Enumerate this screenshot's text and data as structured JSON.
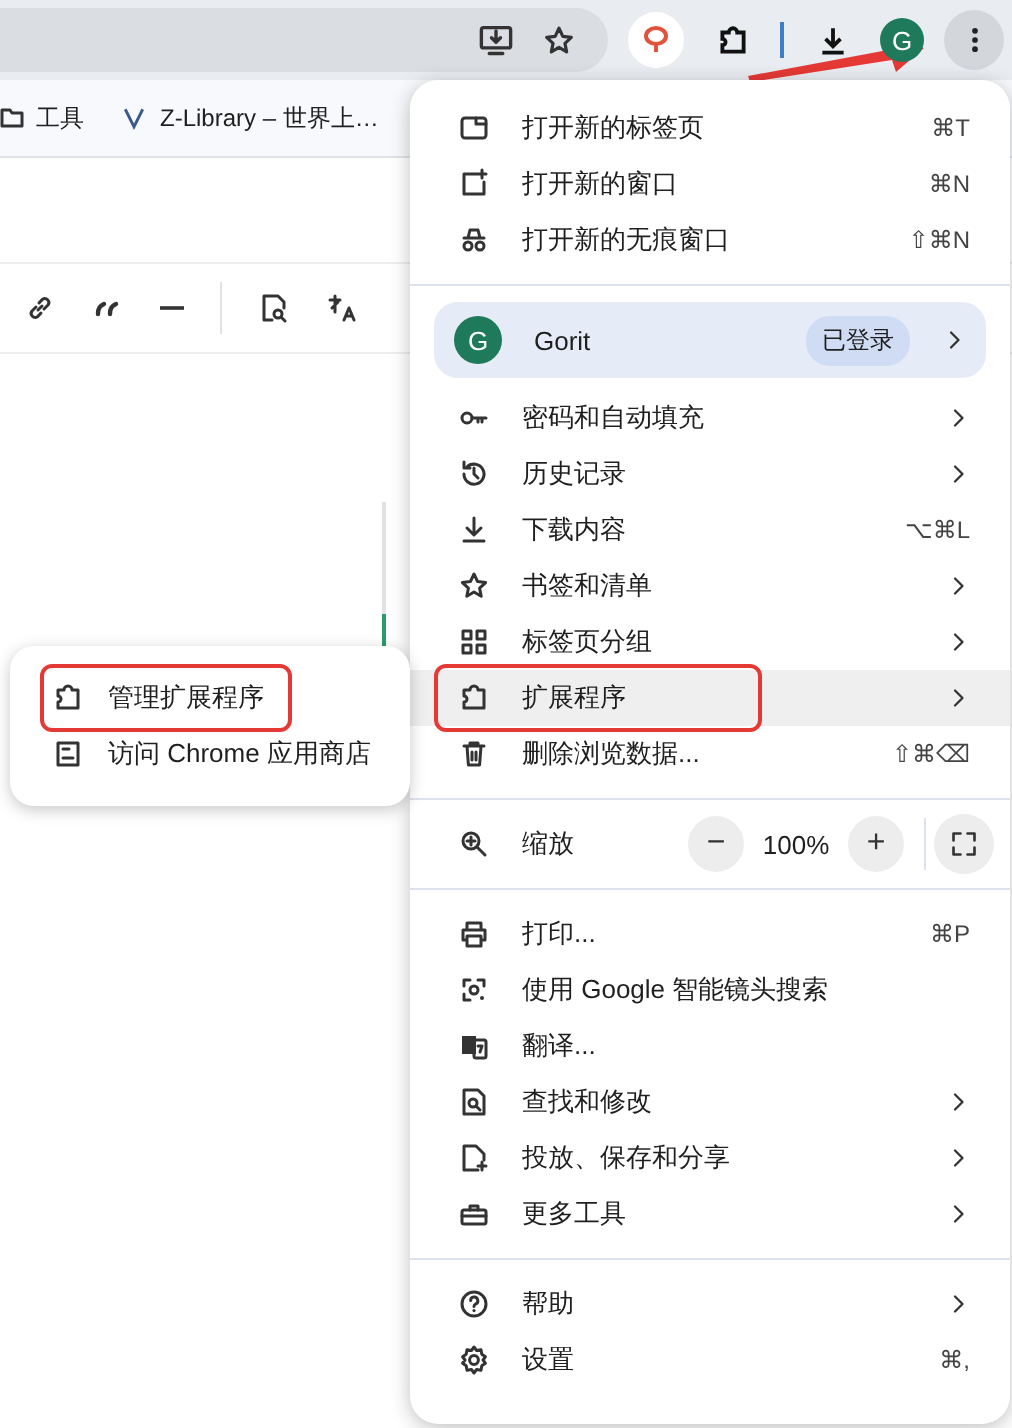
{
  "toolbar": {
    "avatar": "G",
    "bookmarks": [
      {
        "label": "工具"
      },
      {
        "label": "Z-Library – 世界上…"
      }
    ]
  },
  "menu": {
    "sections": [
      [
        {
          "kind": "item",
          "label": "打开新的标签页",
          "shortcut": "⌘T",
          "submenu": false,
          "selected": false,
          "annotated": false
        },
        {
          "kind": "item",
          "label": "打开新的窗口",
          "shortcut": "⌘N",
          "submenu": false,
          "selected": false,
          "annotated": false
        },
        {
          "kind": "item",
          "label": "打开新的无痕窗口",
          "shortcut": "⇧⌘N",
          "submenu": false,
          "selected": false,
          "annotated": false
        }
      ],
      [
        {
          "kind": "profile",
          "avatar": "G",
          "label": "Gorit",
          "badge": "已登录",
          "submenu": true
        },
        {
          "kind": "item",
          "label": "密码和自动填充",
          "submenu": true,
          "selected": false,
          "annotated": false
        },
        {
          "kind": "item",
          "label": "历史记录",
          "submenu": true,
          "selected": false,
          "annotated": false
        },
        {
          "kind": "item",
          "label": "下载内容",
          "shortcut": "⌥⌘L",
          "submenu": false,
          "selected": false,
          "annotated": false
        },
        {
          "kind": "item",
          "label": "书签和清单",
          "submenu": true,
          "selected": false,
          "annotated": false
        },
        {
          "kind": "item",
          "label": "标签页分组",
          "submenu": true,
          "selected": false,
          "annotated": false
        },
        {
          "kind": "item",
          "label": "扩展程序",
          "submenu": true,
          "selected": true,
          "annotated": true
        },
        {
          "kind": "item",
          "label": "删除浏览数据...",
          "shortcut": "⇧⌘⌫",
          "submenu": false,
          "selected": false,
          "annotated": false
        }
      ],
      [
        {
          "kind": "zoom",
          "label": "缩放",
          "minus": "−",
          "value": "100%",
          "plus": "+"
        }
      ],
      [
        {
          "kind": "item",
          "label": "打印...",
          "shortcut": "⌘P",
          "submenu": false,
          "selected": false,
          "annotated": false
        },
        {
          "kind": "item",
          "label": "使用 Google 智能镜头搜索",
          "submenu": false,
          "selected": false,
          "annotated": false
        },
        {
          "kind": "item",
          "label": "翻译...",
          "submenu": false,
          "selected": false,
          "annotated": false
        },
        {
          "kind": "item",
          "label": "查找和修改",
          "submenu": true,
          "selected": false,
          "annotated": false
        },
        {
          "kind": "item",
          "label": "投放、保存和分享",
          "submenu": true,
          "selected": false,
          "annotated": false
        },
        {
          "kind": "item",
          "label": "更多工具",
          "submenu": true,
          "selected": false,
          "annotated": false
        }
      ],
      [
        {
          "kind": "item",
          "label": "帮助",
          "submenu": true,
          "selected": false,
          "annotated": false
        },
        {
          "kind": "item",
          "label": "设置",
          "shortcut": "⌘,",
          "submenu": false,
          "selected": false,
          "annotated": false
        }
      ]
    ]
  },
  "submenu": {
    "items": [
      {
        "label": "管理扩展程序",
        "annotated": true
      },
      {
        "label": "访问 Chrome 应用商店",
        "annotated": false
      }
    ]
  }
}
